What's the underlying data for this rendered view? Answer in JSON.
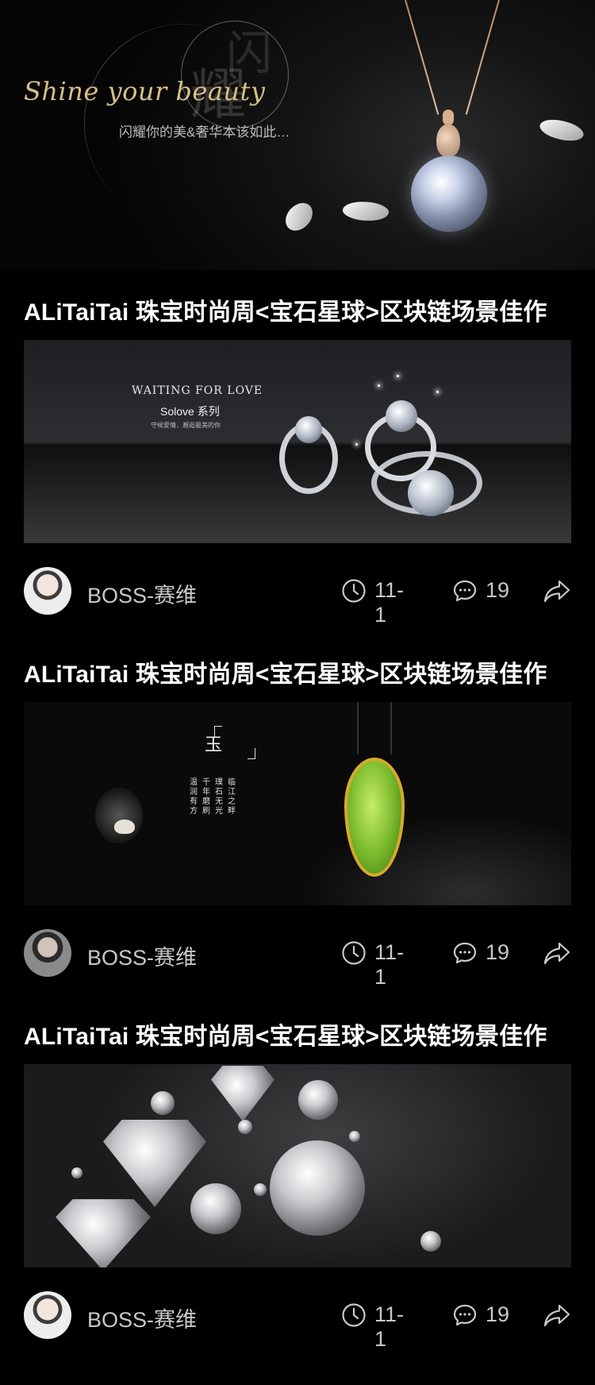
{
  "hero": {
    "script": "Shine your beauty",
    "tagline": "闪耀你的美&奢华本该如此…",
    "ghost_big": "耀",
    "ghost_small": "闪"
  },
  "articles": [
    {
      "title": "ALiTaiTai 珠宝时尚周<宝石星球>区块链场景佳作",
      "image": {
        "kind": "rings",
        "line1": "WAITING FOR LOVE",
        "line2": "Solove 系列",
        "line3": "守候爱情，邂逅最美的你"
      },
      "author": "BOSS-赛维",
      "date": "11-1",
      "comments": "19"
    },
    {
      "title": "ALiTaiTai 珠宝时尚周<宝石星球>区块链场景佳作",
      "image": {
        "kind": "jade",
        "heading": "玉",
        "col1": "临江之畔",
        "col2": "璞石无光",
        "col3": "千年磨刷",
        "col4": "温润有方"
      },
      "author": "BOSS-赛维",
      "date": "11-1",
      "comments": "19"
    },
    {
      "title": "ALiTaiTai 珠宝时尚周<宝石星球>区块链场景佳作",
      "image": {
        "kind": "diamonds"
      },
      "author": "BOSS-赛维",
      "date": "11-1",
      "comments": "19"
    }
  ],
  "icons": {
    "date": "clock-icon",
    "comments": "comment-bubble-icon",
    "share": "share-arrow-icon"
  },
  "colors": {
    "background": "#000000",
    "title": "#ffffff",
    "meta_text": "#c8c8c8",
    "hero_script": "#d8bf86"
  }
}
